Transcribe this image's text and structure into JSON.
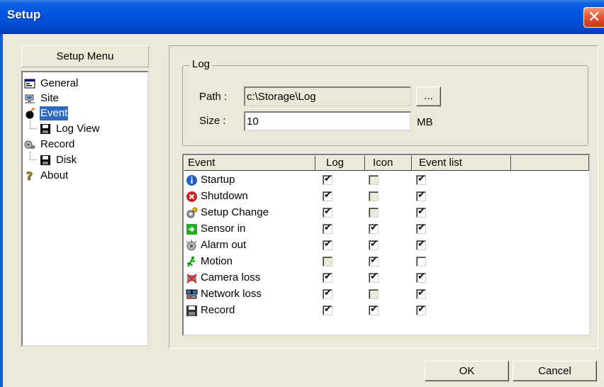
{
  "window": {
    "title": "Setup",
    "close_glyph": "✕"
  },
  "menu": {
    "header": "Setup Menu",
    "items": [
      {
        "label": "General",
        "icon": "general-icon",
        "selected": false
      },
      {
        "label": "Site",
        "icon": "site-icon",
        "selected": false
      },
      {
        "label": "Event",
        "icon": "event-icon",
        "selected": true
      },
      {
        "label": "Log View",
        "icon": "floppy-icon",
        "selected": false
      },
      {
        "label": "Record",
        "icon": "record-icon",
        "selected": false
      },
      {
        "label": "Disk",
        "icon": "floppy-icon",
        "selected": false
      },
      {
        "label": "About",
        "icon": "about-icon",
        "selected": false
      }
    ]
  },
  "log": {
    "group_title": "Log",
    "path_label": "Path :",
    "path_value": "c:\\Storage\\Log",
    "browse_label": "...",
    "size_label": "Size :",
    "size_value": "10",
    "size_unit": "MB"
  },
  "events": {
    "columns": [
      "Event",
      "Log",
      "Icon",
      "Event list"
    ],
    "rows": [
      {
        "name": "Startup",
        "icon": "info-icon",
        "log": true,
        "icon_checked": false,
        "icon_enabled": false,
        "event_list": true,
        "log_enabled": true
      },
      {
        "name": "Shutdown",
        "icon": "shutdown-icon",
        "log": true,
        "icon_checked": false,
        "icon_enabled": false,
        "event_list": true,
        "log_enabled": true
      },
      {
        "name": "Setup Change",
        "icon": "setup-change-icon",
        "log": true,
        "icon_checked": false,
        "icon_enabled": false,
        "event_list": true,
        "log_enabled": true
      },
      {
        "name": "Sensor in",
        "icon": "sensor-in-icon",
        "log": true,
        "icon_checked": true,
        "icon_enabled": true,
        "event_list": true,
        "log_enabled": true
      },
      {
        "name": "Alarm out",
        "icon": "alarm-out-icon",
        "log": true,
        "icon_checked": true,
        "icon_enabled": true,
        "event_list": true,
        "log_enabled": true
      },
      {
        "name": "Motion",
        "icon": "motion-icon",
        "log": false,
        "icon_checked": true,
        "icon_enabled": true,
        "event_list": false,
        "log_enabled": false
      },
      {
        "name": "Camera loss",
        "icon": "camera-loss-icon",
        "log": true,
        "icon_checked": true,
        "icon_enabled": true,
        "event_list": true,
        "log_enabled": true
      },
      {
        "name": "Network loss",
        "icon": "network-loss-icon",
        "log": true,
        "icon_checked": false,
        "icon_enabled": false,
        "event_list": true,
        "log_enabled": true
      },
      {
        "name": "Record",
        "icon": "record-floppy-icon",
        "log": true,
        "icon_checked": true,
        "icon_enabled": true,
        "event_list": true,
        "log_enabled": true
      }
    ]
  },
  "buttons": {
    "ok": "OK",
    "cancel": "Cancel"
  },
  "colors": {
    "titlebar": "#0054e3",
    "selection": "#316ac5",
    "dialog_bg": "#ECE9D8"
  }
}
